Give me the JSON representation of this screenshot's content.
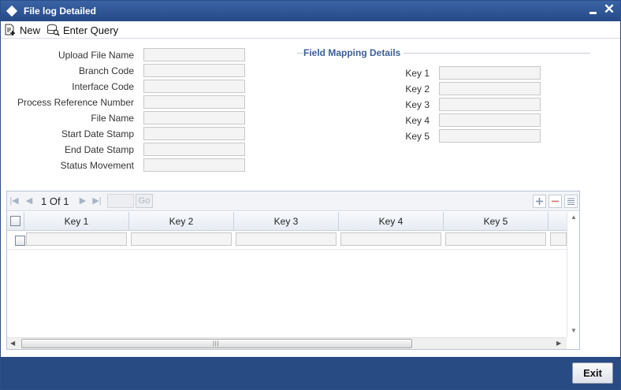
{
  "window": {
    "title": "File log Detailed"
  },
  "toolbar": {
    "new_label": "New",
    "enter_query_label": "Enter Query"
  },
  "form": {
    "fields": [
      {
        "label": "Upload File Name",
        "value": ""
      },
      {
        "label": "Branch Code",
        "value": ""
      },
      {
        "label": "Interface Code",
        "value": ""
      },
      {
        "label": "Process Reference Number",
        "value": ""
      },
      {
        "label": "File Name",
        "value": ""
      },
      {
        "label": "Start Date Stamp",
        "value": ""
      },
      {
        "label": "End Date Stamp",
        "value": ""
      },
      {
        "label": "Status Movement",
        "value": ""
      }
    ]
  },
  "field_mapping": {
    "legend": "Field Mapping Details",
    "keys": [
      {
        "label": "Key 1",
        "value": ""
      },
      {
        "label": "Key 2",
        "value": ""
      },
      {
        "label": "Key 3",
        "value": ""
      },
      {
        "label": "Key 4",
        "value": ""
      },
      {
        "label": "Key 5",
        "value": ""
      }
    ]
  },
  "grid": {
    "page_current": "1",
    "page_of": "Of",
    "page_total": "1",
    "page_input": "",
    "go_label": "Go",
    "columns": [
      "Key 1",
      "Key 2",
      "Key 3",
      "Key 4",
      "Key 5"
    ],
    "rows": [
      [
        "",
        "",
        "",
        "",
        ""
      ]
    ]
  },
  "footer": {
    "exit_label": "Exit"
  }
}
